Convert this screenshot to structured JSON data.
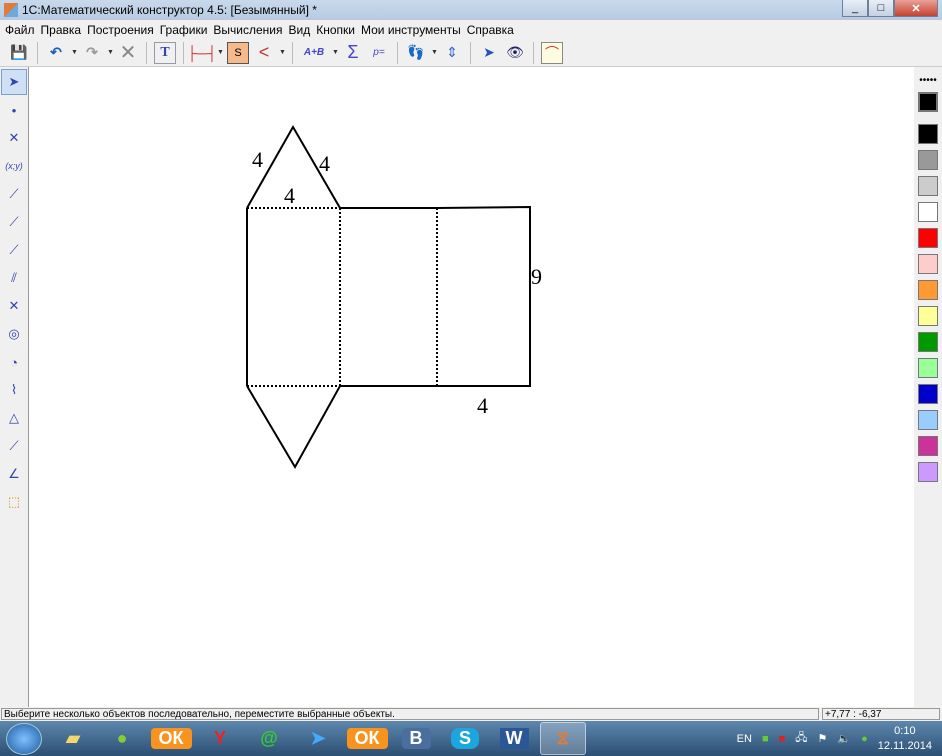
{
  "window": {
    "title": "1С:Математический конструктор 4.5: [Безымянный] *"
  },
  "menu": [
    "Файл",
    "Правка",
    "Построения",
    "Графики",
    "Вычисления",
    "Вид",
    "Кнопки",
    "Мои инструменты",
    "Справка"
  ],
  "toolbar": {
    "text_tool": "T",
    "expr_tool": "A+B",
    "sum_tool": "Σ",
    "param_tool": "p="
  },
  "left_tools": {
    "coord_label": "(x;y)"
  },
  "drawing": {
    "labels": {
      "left_triangle_side": "4",
      "right_triangle_side": "4",
      "triangle_base": "4",
      "height": "9",
      "bottom_width": "4"
    }
  },
  "palette": [
    "#000000",
    "#999999",
    "#cccccc",
    "#ffffff",
    "#ff0000",
    "#ffcccc",
    "#ff9933",
    "#ffff99",
    "#009900",
    "#99ff99",
    "#0000cc",
    "#99ccff",
    "#cc3399",
    "#cc99ff"
  ],
  "status": {
    "message": "Выберите несколько объектов последовательно, переместите выбранные объекты.",
    "coords": "+7,77 : -6,37"
  },
  "taskbar": {
    "lang": "EN",
    "time": "0:10",
    "date": "12.11.2014",
    "apps": [
      "Проводник",
      "Яндекс",
      "Одноклассники",
      "Яндекс.Браузер",
      "Mail.Ru Агент",
      "Приложение",
      "Одноклассники",
      "ВКонтакте",
      "Skype",
      "Word",
      "Математический конструктор"
    ]
  }
}
